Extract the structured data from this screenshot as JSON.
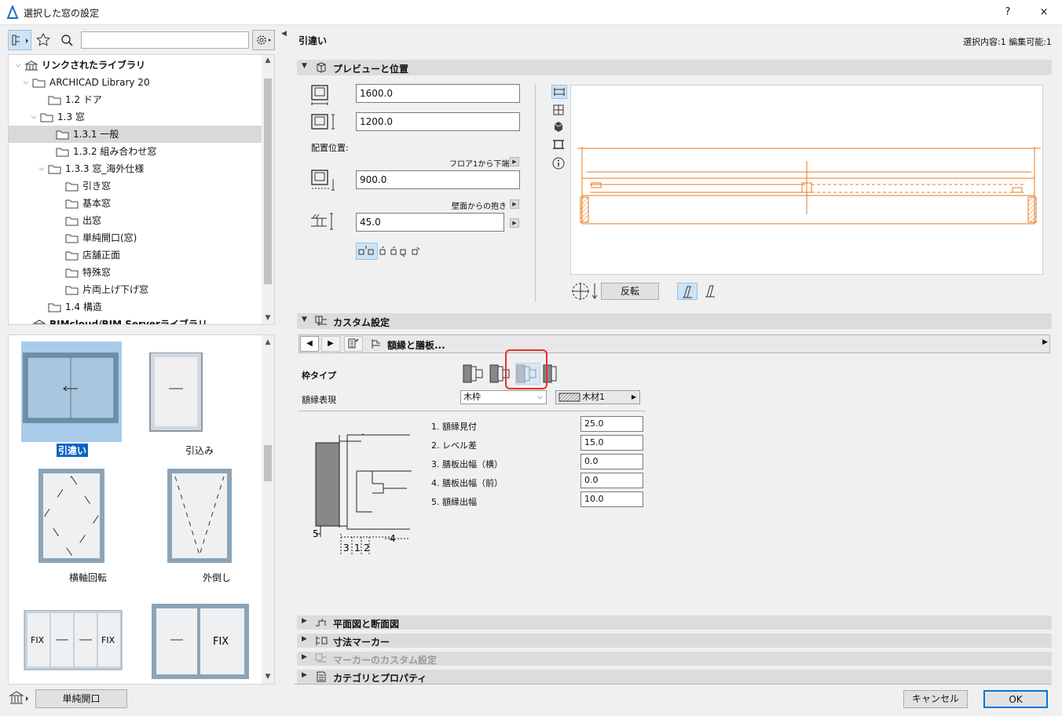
{
  "window": {
    "title": "選択した窓の設定",
    "help": "?",
    "close": "×"
  },
  "library": {
    "search": {
      "value": "",
      "placeholder": ""
    },
    "tree": [
      {
        "label": "リンクされたライブラリ",
        "bold": true
      },
      {
        "label": "ARCHICAD Library 20"
      },
      {
        "label": "1.2 ドア"
      },
      {
        "label": "1.3 窓"
      },
      {
        "label": "1.3.1 一般",
        "selected": true
      },
      {
        "label": "1.3.2 組み合わせ窓"
      },
      {
        "label": "1.3.3 窓_海外仕様"
      },
      {
        "label": "引き窓"
      },
      {
        "label": "基本窓"
      },
      {
        "label": "出窓"
      },
      {
        "label": "単純開口(窓)"
      },
      {
        "label": "店舗正面"
      },
      {
        "label": "特殊窓"
      },
      {
        "label": "片両上げ下げ窓"
      },
      {
        "label": "1.4 構造"
      },
      {
        "label": "BIMcloud/BIM Serverライブラリ",
        "bold": true
      }
    ],
    "gallery": [
      {
        "label": "引違い",
        "selected": true,
        "icon": "sliding-window-icon"
      },
      {
        "label": "引込み",
        "icon": "pocket-window-icon"
      },
      {
        "label": "横軸回転",
        "icon": "pivot-window-icon"
      },
      {
        "label": "外倒し",
        "icon": "hopper-window-icon"
      },
      {
        "label": "FIX",
        "icon": "fix-sliding-window-icon"
      },
      {
        "label": "FIX",
        "icon": "fix-window-icon"
      }
    ],
    "bottom_button": "単純開口"
  },
  "header": {
    "object_name": "引違い",
    "selection_info": "選択内容:1 編集可能:1"
  },
  "preview_section": {
    "title": "プレビューと位置",
    "width_value": "1600.0",
    "height_value": "1200.0",
    "placement_label": "配置位置:",
    "sill_ref_label": "フロア1から下端",
    "sill_value": "900.0",
    "reveal_label": "壁面からの抱き",
    "reveal_value": "45.0",
    "flip_button": "反転"
  },
  "custom_section": {
    "title": "カスタム設定",
    "page_title": "額縁と膳板...",
    "frame_type_label": "枠タイプ",
    "casing_label": "額縁表現",
    "casing_value": "木枠",
    "material_value": "木材1",
    "params": [
      {
        "label": "1. 額縁見付",
        "value": "25.0"
      },
      {
        "label": "2. レベル差",
        "value": "15.0"
      },
      {
        "label": "3. 膳板出幅（横）",
        "value": "0.0"
      },
      {
        "label": "4. 膳板出幅（前）",
        "value": "0.0"
      },
      {
        "label": "5. 額縁出幅",
        "value": "10.0"
      }
    ],
    "diagram_labels": {
      "n5": "5",
      "n4": "4",
      "n3": "3",
      "n1": "1",
      "n2": "2"
    }
  },
  "collapsed_sections": [
    {
      "label": "平面図と断面図",
      "disabled": false
    },
    {
      "label": "寸法マーカー",
      "disabled": false
    },
    {
      "label": "マーカーのカスタム設定",
      "disabled": true
    },
    {
      "label": "カテゴリとプロパティ",
      "disabled": false
    }
  ],
  "footer": {
    "cancel": "キャンセル",
    "ok": "OK"
  },
  "colors": {
    "drawing": "#e8781e",
    "selection": "#0a64c8",
    "highlight": "#e53030"
  }
}
